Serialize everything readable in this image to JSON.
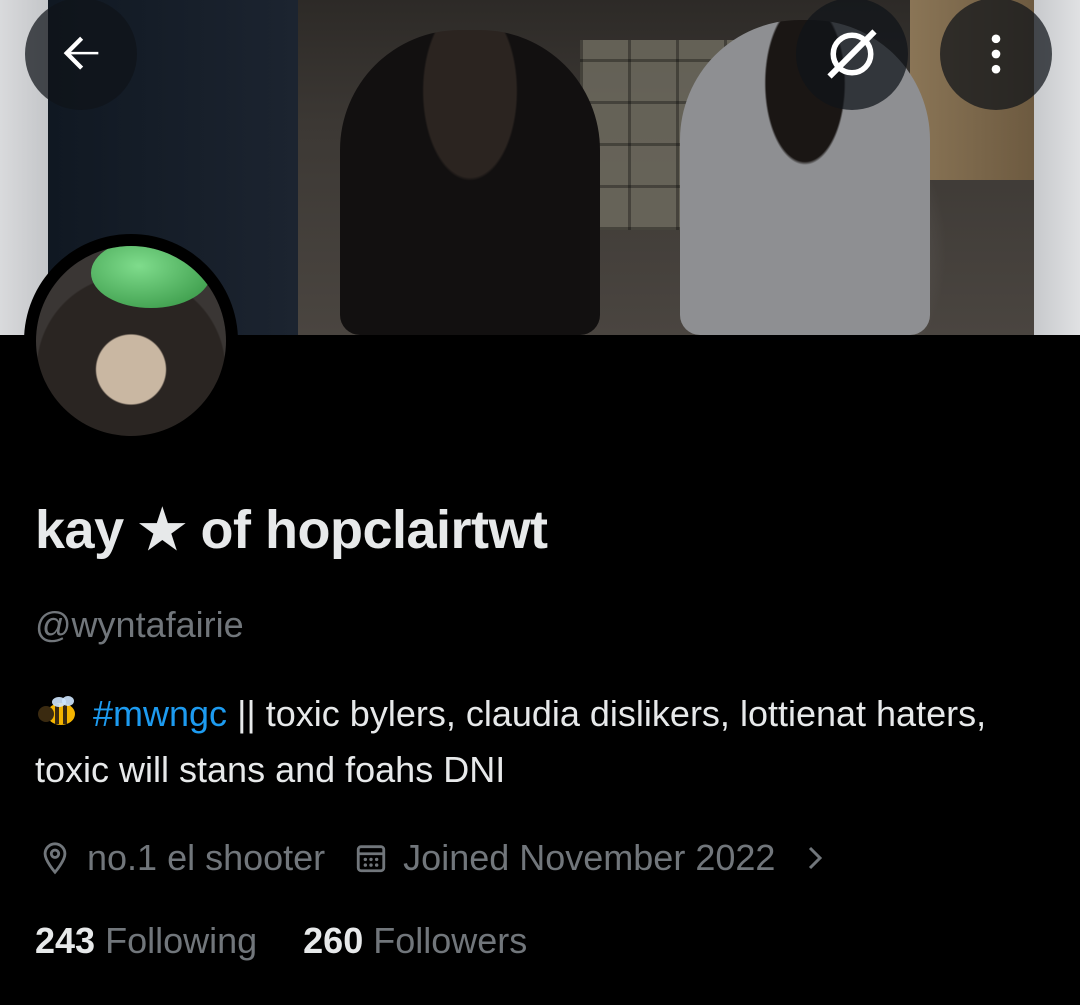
{
  "profile": {
    "display_name": "kay ★ of hopclairtwt",
    "handle": "@wyntafairie",
    "bio": {
      "emoji": "bee-icon",
      "hashtag": "#mwngc",
      "text": " || toxic bylers, claudia dislikers, lottienat haters, toxic will stans and foahs DNI"
    },
    "location": "no.1 el shooter",
    "joined": "Joined November 2022",
    "following_count": "243",
    "following_label": "Following",
    "followers_count": "260",
    "followers_label": "Followers"
  },
  "icons": {
    "back": "arrow-left-icon",
    "grok": "grok-icon",
    "more": "more-vertical-icon",
    "location": "location-pin-icon",
    "calendar": "calendar-icon",
    "chevron": "chevron-right-icon"
  },
  "colors": {
    "background": "#000000",
    "primary_text": "#e7e9ea",
    "secondary_text": "#71767b",
    "link": "#1d9bf0"
  }
}
